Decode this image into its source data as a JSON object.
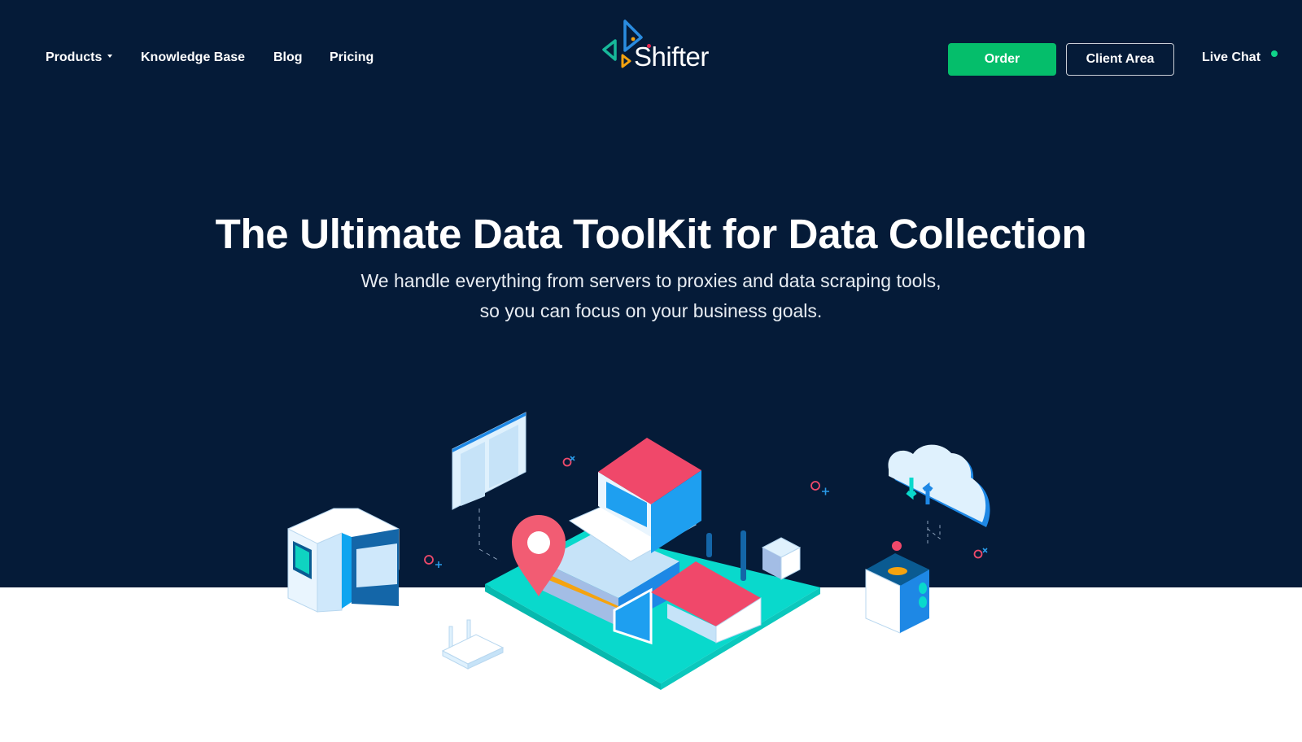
{
  "brand": {
    "name": "Shifter",
    "colors": {
      "hero_background": "#051b38",
      "order_button": "#05be6b",
      "live_dot": "#0fd389",
      "logo_blue": "#2a8ce0",
      "logo_green": "#17b89a",
      "logo_orange": "#f5a30f",
      "logo_dot_red": "#e6244d"
    }
  },
  "nav": {
    "items": [
      {
        "label": "Products",
        "has_dropdown": true
      },
      {
        "label": "Knowledge Base"
      },
      {
        "label": "Blog"
      },
      {
        "label": "Pricing"
      }
    ],
    "order_label": "Order",
    "client_area_label": "Client Area",
    "live_chat_label": "Live Chat",
    "live_chat_status": "online"
  },
  "hero": {
    "title": "The Ultimate Data ToolKit for Data Collection",
    "subtitle_line1": "We handle everything from servers to proxies and data scraping tools,",
    "subtitle_line2": "so you can focus on your business goals."
  },
  "illustration": {
    "icons": [
      "browser-window-icon",
      "server-machine-icon",
      "router-icon",
      "house-map-icon",
      "location-pin-icon",
      "cloud-sync-icon",
      "database-box-icon",
      "robot-cube-icon"
    ]
  }
}
